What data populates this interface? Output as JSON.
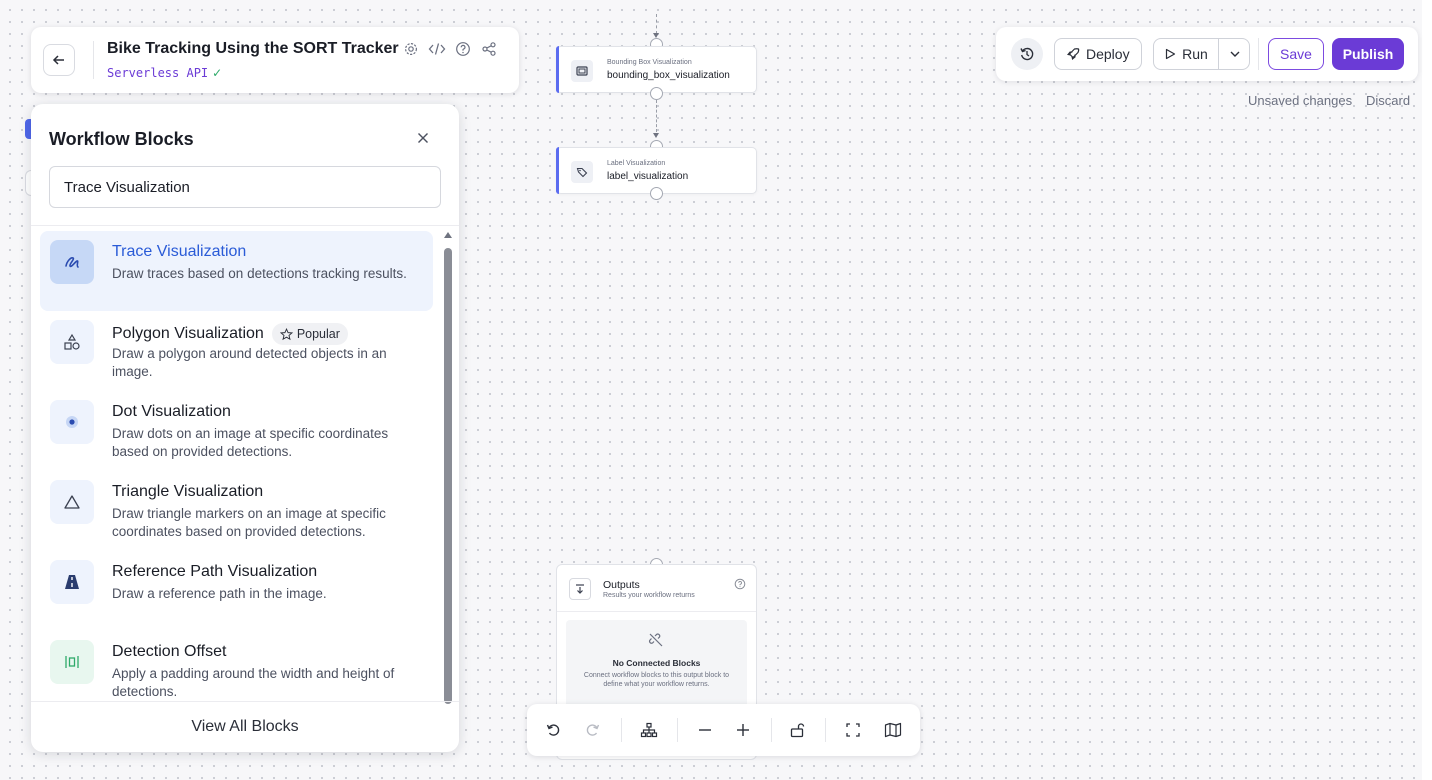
{
  "header": {
    "title": "Bike Tracking Using the SORT Tracker",
    "subtitle": "Serverless API",
    "subtitle_check": "✓"
  },
  "panel": {
    "title": "Workflow Blocks",
    "search_value": "Trace Visualization",
    "items": [
      {
        "name": "Trace Visualization",
        "desc": "Draw traces based on detections tracking results.",
        "icon": "trace-icon",
        "active": true
      },
      {
        "name": "Polygon Visualization",
        "desc": "Draw a polygon around detected objects in an image.",
        "icon": "polygon-icon",
        "badge": "Popular"
      },
      {
        "name": "Dot Visualization",
        "desc": "Draw dots on an image at specific coordinates based on provided detections.",
        "icon": "dot-icon"
      },
      {
        "name": "Triangle Visualization",
        "desc": "Draw triangle markers on an image at specific coordinates based on provided detections.",
        "icon": "triangle-icon"
      },
      {
        "name": "Reference Path Visualization",
        "desc": "Draw a reference path in the image.",
        "icon": "road-icon"
      },
      {
        "name": "Detection Offset",
        "desc": "Apply a padding around the width and height of detections.",
        "icon": "offset-icon"
      }
    ],
    "view_all": "View All Blocks"
  },
  "nodes": {
    "bbox": {
      "type": "Bounding Box Visualization",
      "name": "bounding_box_visualization"
    },
    "label": {
      "type": "Label Visualization",
      "name": "label_visualization"
    },
    "outputs": {
      "title": "Outputs",
      "subtitle": "Results your workflow returns",
      "empty_title": "No Connected Blocks",
      "empty_desc": "Connect workflow blocks to this output block to define what your workflow returns."
    }
  },
  "actions": {
    "deploy": "Deploy",
    "run": "Run",
    "save": "Save",
    "publish": "Publish",
    "unsaved": "Unsaved changes",
    "discard": "Discard"
  },
  "colors": {
    "accent": "#6b3bd6",
    "active_item": "#2a5bd7",
    "node_accent": "#5b6cf0"
  }
}
